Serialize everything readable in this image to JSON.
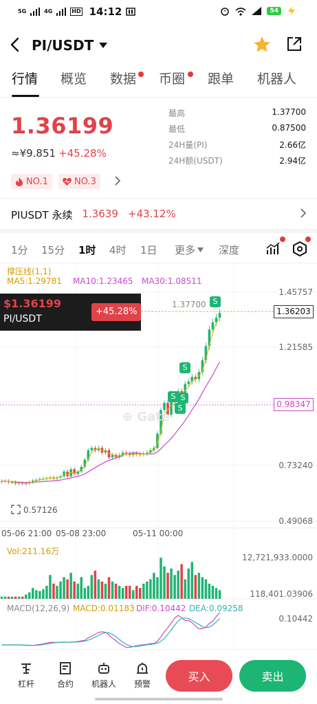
{
  "status_bar": {
    "signal_1": "5G",
    "signal_2": "4G",
    "hd": "HD",
    "time": "14:12",
    "battery": "54"
  },
  "nav": {
    "pair": "PI/USDT"
  },
  "tabs": [
    {
      "label": "行情",
      "dot": false
    },
    {
      "label": "概览",
      "dot": false
    },
    {
      "label": "数据",
      "dot": true
    },
    {
      "label": "币圈",
      "dot": true
    },
    {
      "label": "跟单",
      "dot": false
    },
    {
      "label": "机器人",
      "dot": false
    }
  ],
  "ticker": {
    "price": "1.36199",
    "cny": "≈¥9.851",
    "change": "+45.28%",
    "badge1": "NO.1",
    "badge2": "NO.3",
    "stats": [
      {
        "k": "最高",
        "v": "1.37700"
      },
      {
        "k": "最低",
        "v": "0.87500"
      },
      {
        "k": "24H量(PI)",
        "v": "2.66亿"
      },
      {
        "k": "24H额(USDT)",
        "v": "2.94亿"
      }
    ]
  },
  "perpetual": {
    "name": "PIUSDT 永续",
    "price": "1.3639",
    "change": "+43.12%"
  },
  "timeframes": {
    "t1": "1分",
    "t2": "15分",
    "t3": "1时",
    "t4": "4时",
    "t5": "1日",
    "more": "更多",
    "depth": "深度"
  },
  "indicators": {
    "pressure": "撑压线(1,1)",
    "ma5": "MA5:1.29781",
    "ma10": "MA10:1.23465",
    "ma30": "MA30:1.08511",
    "vol": "Vol:211.16万",
    "macd_label": "MACD(12,26,9)",
    "macd": "MACD:0.01183",
    "dif": "DIF:0.10442",
    "dea": "DEA:0.09258"
  },
  "overlay": {
    "price": "$1.36199",
    "pair": "PI/USDT",
    "change": "+45.28%"
  },
  "chart_data": {
    "type": "candlestick",
    "y_ticks": [
      "1.45757",
      "1.21585",
      "0.73240",
      "0.49068"
    ],
    "x_ticks": [
      "05-06 21:00",
      "05-08 23:00",
      "05-11 00:00"
    ],
    "current_price_tag": "1.36203",
    "crosshair_tag": "0.98347",
    "high_label": "1.37700",
    "low_label": "0.57126",
    "high_marker": "S",
    "vol_ticks": [
      "12,721,933.0000",
      "118,401.03906"
    ],
    "macd_tick": "0.10442",
    "ylim": [
      0.49068,
      1.45757
    ],
    "close": [
      0.66,
      0.66,
      0.655,
      0.655,
      0.65,
      0.652,
      0.648,
      0.65,
      0.655,
      0.662,
      0.665,
      0.668,
      0.67,
      0.672,
      0.675,
      0.67,
      0.675,
      0.68,
      0.7,
      0.68,
      0.71,
      0.69,
      0.7,
      0.72,
      0.75,
      0.79,
      0.8,
      0.79,
      0.8,
      0.78,
      0.79,
      0.76,
      0.77,
      0.76,
      0.77,
      0.78,
      0.775,
      0.77,
      0.778,
      0.774,
      0.772,
      0.776,
      0.78,
      0.79,
      0.8,
      0.86,
      0.96,
      0.99,
      0.94,
      1.0,
      1.02,
      1.04,
      1.02,
      1.07,
      1.08,
      1.1,
      1.09,
      1.12,
      1.17,
      1.23,
      1.3,
      1.33,
      1.35,
      1.37
    ],
    "volume": [
      0.05,
      0.05,
      0.05,
      0.05,
      0.05,
      0.05,
      0.05,
      0.1,
      0.15,
      0.25,
      0.2,
      0.18,
      0.22,
      0.3,
      0.55,
      0.35,
      0.3,
      0.4,
      0.5,
      0.45,
      0.6,
      0.4,
      0.35,
      0.5,
      0.25,
      0.3,
      0.55,
      0.65,
      0.45,
      0.4,
      0.35,
      0.5,
      0.4,
      0.35,
      0.3,
      0.25,
      0.3,
      0.3,
      0.2,
      0.3,
      0.25,
      0.35,
      0.4,
      0.45,
      0.6,
      0.5,
      0.95,
      0.75,
      0.6,
      0.7,
      0.55,
      0.65,
      0.8,
      0.45,
      0.7,
      0.85,
      0.55,
      0.6,
      0.5,
      0.45,
      0.35,
      0.3,
      0.25,
      0.2
    ]
  }
}
